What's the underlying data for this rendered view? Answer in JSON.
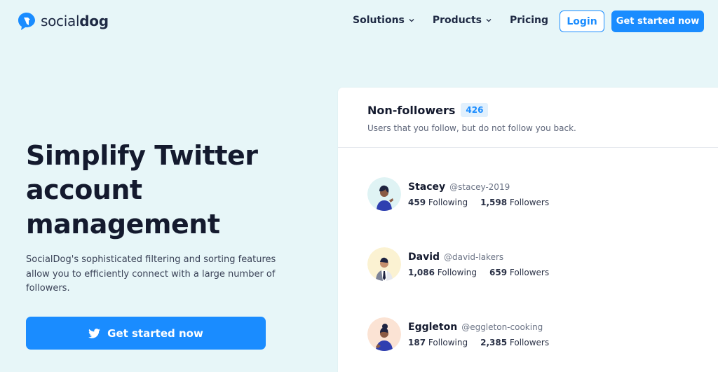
{
  "header": {
    "logo_text_a": "social",
    "logo_text_b": "dog",
    "nav": [
      {
        "label": "Solutions",
        "icon": "chevron-down-icon"
      },
      {
        "label": "Products",
        "icon": "chevron-down-icon"
      },
      {
        "label": "Pricing"
      }
    ],
    "login_label": "Login",
    "cta_label": "Get started now"
  },
  "hero": {
    "title_lines": [
      "Simplify Twitter",
      "account",
      "management"
    ],
    "description": "SocialDog's sophisticated filtering and sorting features allow you to efficiently connect with a large number of followers.",
    "cta_label": "Get started now",
    "cta_icon": "twitter-icon"
  },
  "card": {
    "title": "Non-followers",
    "count": "426",
    "subtitle": "Users that you follow, but do not follow you back.",
    "users": [
      {
        "name": "Stacey",
        "handle": "@stacey-2019",
        "following": "459",
        "following_label": "Following",
        "followers": "1,598",
        "followers_label": "Followers",
        "avatar_bg": "#dff3f4"
      },
      {
        "name": "David",
        "handle": "@david-lakers",
        "following": "1,086",
        "following_label": "Following",
        "followers": "659",
        "followers_label": "Followers",
        "avatar_bg": "#fbf2d2"
      },
      {
        "name": "Eggleton",
        "handle": "@eggleton-cooking",
        "following": "187",
        "following_label": "Following",
        "followers": "2,385",
        "followers_label": "Followers",
        "avatar_bg": "#fbe3d4"
      }
    ]
  },
  "colors": {
    "accent": "#1a8cff",
    "background": "#e7f6f8"
  }
}
